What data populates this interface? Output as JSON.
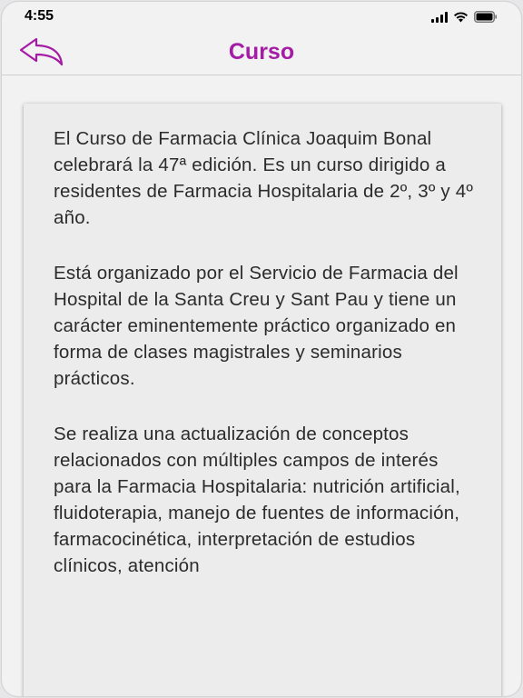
{
  "status_bar": {
    "time": "4:55"
  },
  "nav": {
    "title": "Curso",
    "back_icon": "reply-arrow-icon"
  },
  "content": {
    "paragraphs": [
      "El Curso de Farmacia Clínica Joaquim Bonal celebrará la 47ª edición. Es un curso dirigido a residentes de Farmacia Hospitalaria de 2º, 3º y 4º año.",
      "Está organizado por el Servicio de Farmacia del Hospital de la Santa Creu y Sant Pau y tiene un carácter eminentemente práctico organizado en forma de clases magistrales y seminarios prácticos.",
      "Se realiza una actualización de conceptos relacionados con múltiples campos de interés para la Farmacia Hospitalaria: nutrición artificial, fluidoterapia, manejo de fuentes de información, farmacocinética, interpretación de estudios clínicos, atención"
    ]
  },
  "colors": {
    "accent": "#a51ba5",
    "background": "#f2f2f2",
    "card": "#ececec",
    "text": "#2b2b2b"
  }
}
